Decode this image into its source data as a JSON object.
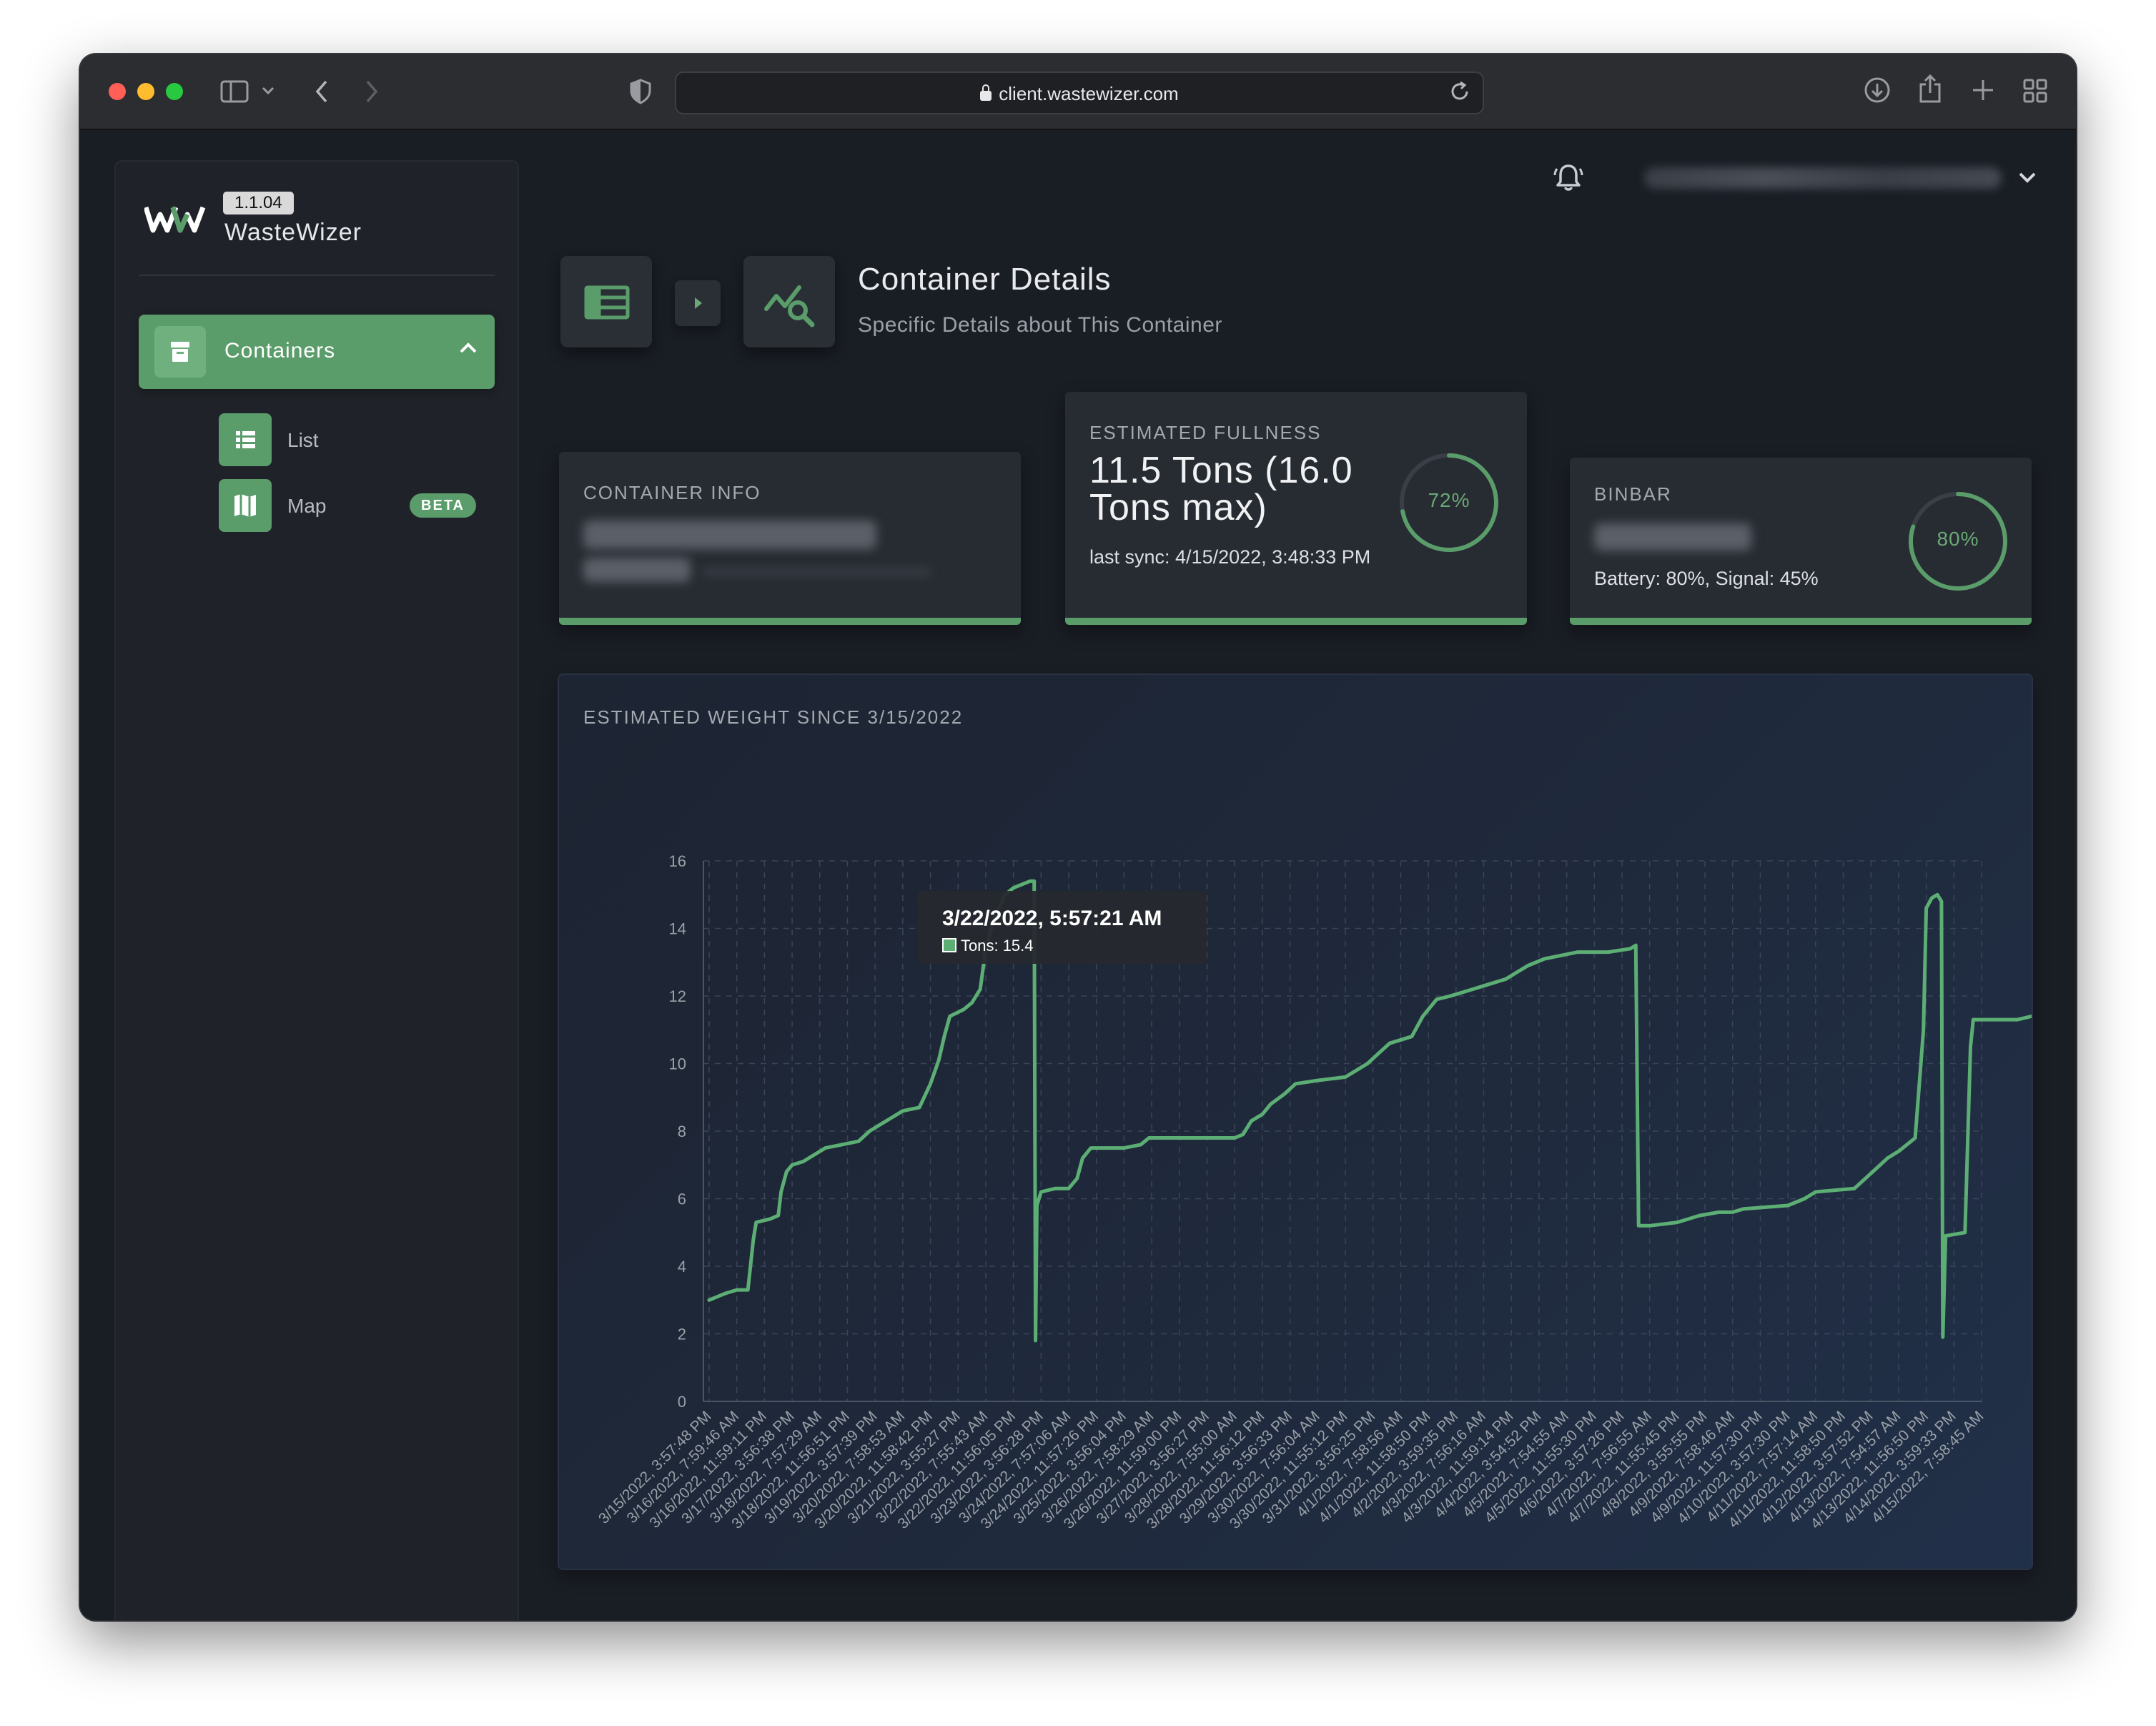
{
  "browser": {
    "url": "client.wastewizer.com"
  },
  "sidebar": {
    "version": "1.1.04",
    "brand": "WasteWizer",
    "nav": {
      "containers_label": "Containers",
      "list_label": "List",
      "map_label": "Map",
      "map_badge": "BETA"
    }
  },
  "header": {
    "title": "Container Details",
    "subtitle": "Specific Details about This Container"
  },
  "cards": {
    "container_info": {
      "label": "CONTAINER INFO"
    },
    "fullness": {
      "label": "ESTIMATED FULLNESS",
      "value": "11.5 Tons (16.0 Tons max)",
      "sync": "last sync: 4/15/2022, 3:48:33 PM",
      "percent_label": "72%",
      "percent": 72
    },
    "binbar": {
      "label": "BINBAR",
      "status": "Battery: 80%, Signal: 45%",
      "percent_label": "80%",
      "percent": 80
    }
  },
  "colors": {
    "accent": "#5a9c6a",
    "line": "#5cae74",
    "gauge_track": "#3a3f47"
  },
  "chart_data": {
    "type": "line",
    "title": "ESTIMATED WEIGHT SINCE 3/15/2022",
    "ylim": [
      0,
      16
    ],
    "yticks": [
      0,
      2,
      4,
      6,
      8,
      10,
      12,
      14,
      16
    ],
    "grid": true,
    "legend": "none",
    "series": [
      {
        "name": "Tons",
        "points": [
          [
            0,
            3.0
          ],
          [
            0.3,
            3.1
          ],
          [
            0.6,
            3.2
          ],
          [
            1.0,
            3.3
          ],
          [
            1.4,
            3.3
          ],
          [
            1.6,
            4.8
          ],
          [
            1.7,
            5.3
          ],
          [
            2.2,
            5.4
          ],
          [
            2.5,
            5.5
          ],
          [
            2.6,
            6.2
          ],
          [
            2.8,
            6.8
          ],
          [
            3.0,
            7.0
          ],
          [
            3.4,
            7.1
          ],
          [
            3.8,
            7.3
          ],
          [
            4.2,
            7.5
          ],
          [
            4.8,
            7.6
          ],
          [
            5.4,
            7.7
          ],
          [
            5.8,
            8.0
          ],
          [
            6.2,
            8.2
          ],
          [
            6.6,
            8.4
          ],
          [
            7.0,
            8.6
          ],
          [
            7.6,
            8.7
          ],
          [
            8.0,
            9.4
          ],
          [
            8.3,
            10.1
          ],
          [
            8.5,
            10.8
          ],
          [
            8.7,
            11.4
          ],
          [
            9.2,
            11.6
          ],
          [
            9.5,
            11.8
          ],
          [
            9.8,
            12.2
          ],
          [
            10.0,
            13.4
          ],
          [
            10.3,
            14.3
          ],
          [
            10.7,
            15.0
          ],
          [
            11.0,
            15.2
          ],
          [
            11.3,
            15.3
          ],
          [
            11.6,
            15.4
          ],
          [
            11.75,
            15.4
          ],
          [
            11.8,
            1.8
          ],
          [
            11.85,
            5.8
          ],
          [
            12.0,
            6.2
          ],
          [
            12.5,
            6.3
          ],
          [
            13.0,
            6.3
          ],
          [
            13.3,
            6.6
          ],
          [
            13.5,
            7.2
          ],
          [
            13.8,
            7.5
          ],
          [
            15.0,
            7.5
          ],
          [
            15.6,
            7.6
          ],
          [
            15.9,
            7.8
          ],
          [
            19.0,
            7.8
          ],
          [
            19.3,
            7.9
          ],
          [
            19.6,
            8.3
          ],
          [
            20.0,
            8.5
          ],
          [
            20.3,
            8.8
          ],
          [
            20.8,
            9.1
          ],
          [
            21.2,
            9.4
          ],
          [
            22.0,
            9.5
          ],
          [
            23.0,
            9.6
          ],
          [
            23.8,
            10.0
          ],
          [
            24.2,
            10.3
          ],
          [
            24.6,
            10.6
          ],
          [
            25.4,
            10.8
          ],
          [
            25.8,
            11.4
          ],
          [
            26.3,
            11.9
          ],
          [
            26.8,
            12.0
          ],
          [
            27.6,
            12.2
          ],
          [
            28.0,
            12.3
          ],
          [
            28.8,
            12.5
          ],
          [
            29.2,
            12.7
          ],
          [
            29.6,
            12.9
          ],
          [
            30.2,
            13.1
          ],
          [
            30.8,
            13.2
          ],
          [
            31.4,
            13.3
          ],
          [
            32.5,
            13.3
          ],
          [
            33.3,
            13.4
          ],
          [
            33.5,
            13.5
          ],
          [
            33.6,
            5.2
          ],
          [
            34.0,
            5.2
          ],
          [
            35.0,
            5.3
          ],
          [
            35.8,
            5.5
          ],
          [
            36.5,
            5.6
          ],
          [
            37.0,
            5.6
          ],
          [
            37.4,
            5.7
          ],
          [
            39.0,
            5.8
          ],
          [
            39.6,
            6.0
          ],
          [
            40.0,
            6.2
          ],
          [
            41.4,
            6.3
          ],
          [
            41.8,
            6.6
          ],
          [
            42.2,
            6.9
          ],
          [
            42.6,
            7.2
          ],
          [
            43.0,
            7.4
          ],
          [
            43.3,
            7.6
          ],
          [
            43.6,
            7.8
          ],
          [
            43.9,
            11.0
          ],
          [
            44.0,
            14.6
          ],
          [
            44.2,
            14.9
          ],
          [
            44.4,
            15.0
          ],
          [
            44.55,
            14.8
          ],
          [
            44.6,
            1.9
          ],
          [
            44.7,
            4.9
          ],
          [
            45.4,
            5.0
          ],
          [
            45.6,
            10.5
          ],
          [
            45.7,
            11.3
          ],
          [
            46.5,
            11.3
          ],
          [
            47.3,
            11.3
          ],
          [
            47.8,
            11.4
          ],
          [
            48.5,
            11.5
          ],
          [
            49.8,
            11.5
          ],
          [
            50.6,
            11.6
          ],
          [
            51.2,
            11.6
          ],
          [
            51.4,
            11.5
          ]
        ]
      }
    ],
    "x_labels": [
      "3/15/2022, 3:57:48 PM",
      "3/16/2022, 7:59:46 AM",
      "3/16/2022, 11:59:11 PM",
      "3/17/2022, 3:56:38 PM",
      "3/18/2022, 7:57:29 AM",
      "3/18/2022, 11:56:51 PM",
      "3/19/2022, 3:57:39 PM",
      "3/20/2022, 7:58:53 AM",
      "3/20/2022, 11:58:42 PM",
      "3/21/2022, 3:55:27 PM",
      "3/22/2022, 7:55:43 AM",
      "3/22/2022, 11:56:05 PM",
      "3/23/2022, 3:56:28 PM",
      "3/24/2022, 7:57:06 AM",
      "3/24/2022, 11:57:26 PM",
      "3/25/2022, 3:56:04 PM",
      "3/26/2022, 7:58:29 AM",
      "3/26/2022, 11:59:00 PM",
      "3/27/2022, 3:56:27 PM",
      "3/28/2022, 7:55:00 AM",
      "3/28/2022, 11:56:12 PM",
      "3/29/2022, 3:56:33 PM",
      "3/30/2022, 7:56:04 AM",
      "3/30/2022, 11:55:12 PM",
      "3/31/2022, 3:56:25 PM",
      "4/1/2022, 7:58:56 AM",
      "4/1/2022, 11:58:50 PM",
      "4/2/2022, 3:59:35 PM",
      "4/3/2022, 7:56:16 AM",
      "4/3/2022, 11:59:14 PM",
      "4/4/2022, 3:54:52 PM",
      "4/5/2022, 7:54:55 AM",
      "4/5/2022, 11:55:30 PM",
      "4/6/2022, 3:57:26 PM",
      "4/7/2022, 7:56:55 AM",
      "4/7/2022, 11:55:45 PM",
      "4/8/2022, 3:55:55 PM",
      "4/9/2022, 7:58:46 AM",
      "4/9/2022, 11:57:30 PM",
      "4/10/2022, 3:57:30 PM",
      "4/11/2022, 7:57:14 AM",
      "4/11/2022, 11:58:50 PM",
      "4/12/2022, 3:57:52 PM",
      "4/13/2022, 7:54:57 AM",
      "4/13/2022, 11:56:50 PM",
      "4/14/2022, 3:59:33 PM",
      "4/15/2022, 7:58:45 AM"
    ],
    "tooltip": {
      "title": "3/22/2022, 5:57:21 AM",
      "item": "Tons: 15.4"
    }
  }
}
